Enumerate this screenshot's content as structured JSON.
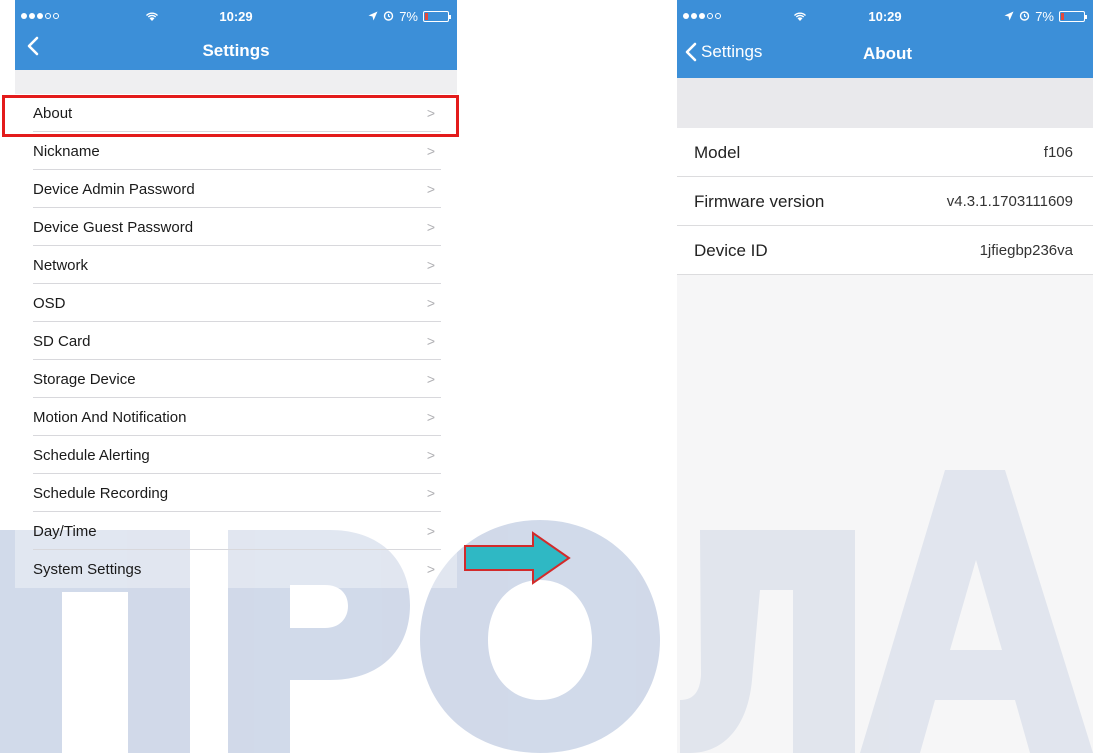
{
  "left_screen": {
    "status": {
      "time": "10:29",
      "battery": "7%"
    },
    "nav_title": "Settings",
    "items": [
      {
        "label": "About",
        "chevron": ">"
      },
      {
        "label": "Nickname",
        "chevron": ">"
      },
      {
        "label": "Device Admin Password",
        "chevron": ">"
      },
      {
        "label": "Device Guest Password",
        "chevron": ">"
      },
      {
        "label": "Network",
        "chevron": ">"
      },
      {
        "label": "OSD",
        "chevron": ">"
      },
      {
        "label": "SD Card",
        "chevron": ">"
      },
      {
        "label": "Storage Device",
        "chevron": ">"
      },
      {
        "label": "Motion And Notification",
        "chevron": ">"
      },
      {
        "label": "Schedule Alerting",
        "chevron": ">"
      },
      {
        "label": "Schedule Recording",
        "chevron": ">"
      },
      {
        "label": "Day/Time",
        "chevron": ">"
      },
      {
        "label": "System Settings",
        "chevron": ">"
      }
    ]
  },
  "right_screen": {
    "status": {
      "time": "10:29",
      "battery": "7%"
    },
    "back_label": "Settings",
    "nav_title": "About",
    "rows": [
      {
        "label": "Model",
        "value": "f106"
      },
      {
        "label": "Firmware version",
        "value": "v4.3.1.1703111609"
      },
      {
        "label": "Device ID",
        "value": "1jfiegbp236va"
      }
    ]
  },
  "colors": {
    "nav_blue": "#3c8fd8",
    "highlight_red": "#e31b1b",
    "arrow_fill": "#2fb8c4",
    "arrow_stroke": "#d22b2b",
    "watermark": "#c9d3e6"
  },
  "icons": [
    "back-chevron-icon",
    "wifi-icon",
    "location-icon",
    "alarm-icon",
    "battery-icon",
    "arrow-right-icon"
  ]
}
